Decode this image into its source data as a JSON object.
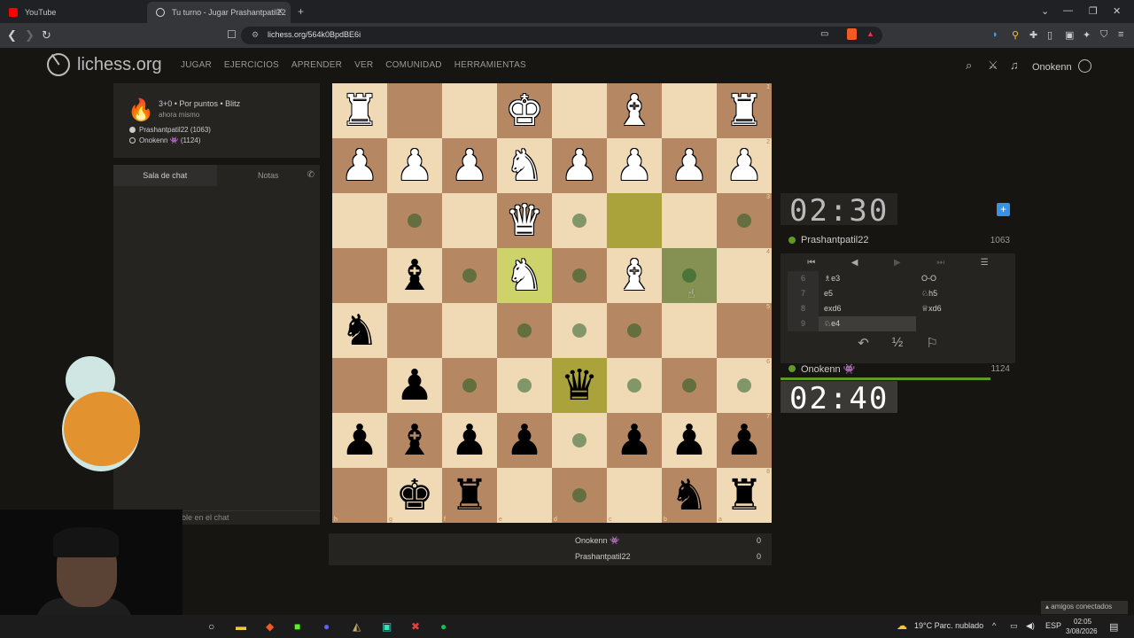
{
  "browser": {
    "tabs": [
      {
        "label": "YouTube",
        "color": "#ff0000"
      },
      {
        "label": "Tu turno - Jugar Prashantpatil22",
        "color": "#ffffff"
      }
    ],
    "url": "lichess.org/564k0BpdBE6i"
  },
  "site": {
    "logo_text": "lichess.org",
    "nav": [
      "JUGAR",
      "EJERCICIOS",
      "APRENDER",
      "VER",
      "COMUNIDAD",
      "HERRAMIENTAS"
    ],
    "username": "Onokenn"
  },
  "game_info": {
    "line1": "3+0 • Por puntos • Blitz",
    "line2": "ahora mismo",
    "white": "Prashantpatil22 (1063)",
    "black": "Onokenn 👾 (1124)"
  },
  "chat": {
    "tab_chat": "Sala de chat",
    "tab_notes": "Notas",
    "input_placeholder": "ble en el chat"
  },
  "board": {
    "ranks": [
      "1",
      "2",
      "3",
      "4",
      "5",
      "6",
      "7",
      "8"
    ],
    "files": [
      "h",
      "g",
      "f",
      "e",
      "d",
      "c",
      "b",
      "a"
    ],
    "rows": [
      [
        "R",
        "",
        "",
        "K",
        "",
        "B",
        "",
        "R"
      ],
      [
        "P",
        "P",
        "P",
        "N",
        "P",
        "P",
        "P",
        "P"
      ],
      [
        "",
        "",
        "",
        "Q",
        "",
        "",
        "",
        ""
      ],
      [
        "",
        "b",
        "",
        "N",
        "",
        "B",
        "",
        ""
      ],
      [
        "n",
        "",
        "",
        "",
        "",
        "",
        "",
        ""
      ],
      [
        "",
        "p",
        "",
        "",
        "q",
        "",
        "",
        ""
      ],
      [
        "p",
        "b",
        "p",
        "p",
        "",
        "p",
        "p",
        "p"
      ],
      [
        "",
        "k",
        "r",
        "",
        "",
        "",
        "n",
        "r"
      ]
    ],
    "move_dots": [
      [
        2,
        1
      ],
      [
        2,
        4
      ],
      [
        2,
        7
      ],
      [
        3,
        2
      ],
      [
        3,
        4
      ],
      [
        3,
        6
      ],
      [
        4,
        3
      ],
      [
        4,
        4
      ],
      [
        4,
        5
      ],
      [
        5,
        2
      ],
      [
        5,
        3
      ],
      [
        5,
        5
      ],
      [
        5,
        6
      ],
      [
        5,
        7
      ],
      [
        6,
        4
      ],
      [
        7,
        4
      ]
    ],
    "highlight_last": [
      [
        2,
        5
      ]
    ],
    "highlight_selected": [
      [
        3,
        3
      ]
    ],
    "highlight_hover": [
      [
        3,
        6
      ]
    ],
    "highlight_check": [
      [
        5,
        4
      ]
    ]
  },
  "crazyhouse": {
    "rows": [
      {
        "name": "Onokenn 👾",
        "score": "0"
      },
      {
        "name": "Prashantpatil22",
        "score": "0"
      }
    ]
  },
  "clock_top": "02:30",
  "clock_bottom": "02:40",
  "opponent": {
    "name": "Prashantpatil22",
    "rating": "1063"
  },
  "me": {
    "name": "Onokenn 👾",
    "rating": "1124"
  },
  "moves": [
    {
      "no": "6",
      "white": "♗e3",
      "black": "O-O"
    },
    {
      "no": "7",
      "white": "e5",
      "black": "♘h5"
    },
    {
      "no": "8",
      "white": "exd6",
      "black": "♕xd6"
    },
    {
      "no": "9",
      "white": "♘e4",
      "black": ""
    }
  ],
  "actions": {
    "takeback": "↶",
    "draw": "½",
    "resign": "⚐"
  },
  "taskbar": {
    "weather": "19°C Parc. nublado",
    "lang": "ESP",
    "time": "02:05",
    "date": "3/08/2026",
    "friends": "amigos conectados"
  }
}
